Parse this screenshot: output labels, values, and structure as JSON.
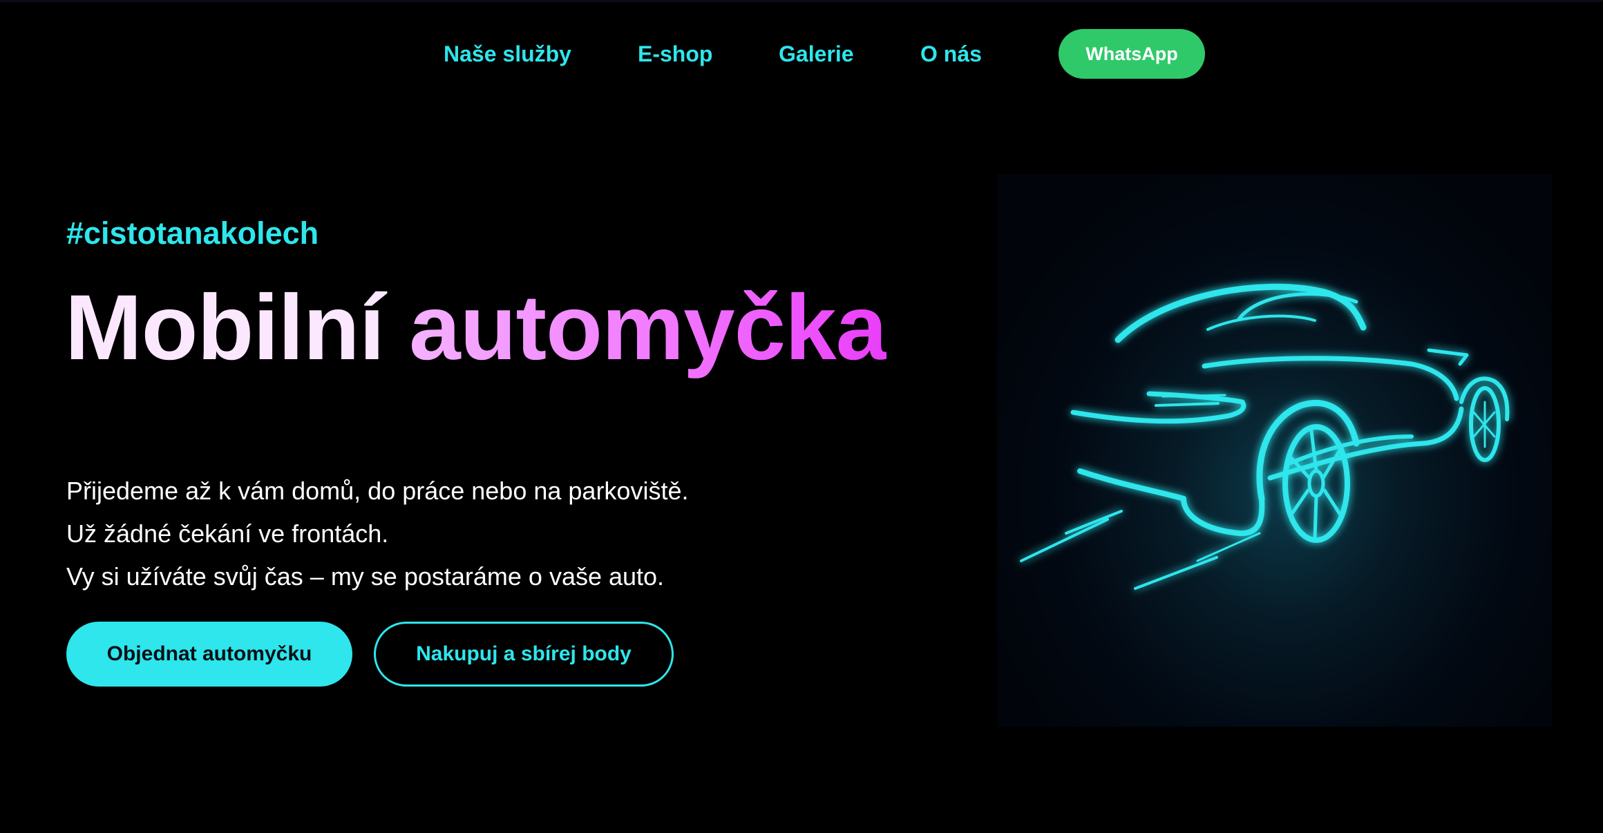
{
  "nav": {
    "links": [
      "Naše služby",
      "E-shop",
      "Galerie",
      "O nás"
    ],
    "whatsapp_label": "WhatsApp"
  },
  "hero": {
    "hashtag": "#cistotanakolech",
    "title_part1": "Mobilní",
    "title_part2": "automyčka",
    "lines": [
      "Přijedeme až k vám domů, do práce nebo na parkoviště.",
      "Už žádné čekání ve frontách.",
      "Vy si užíváte svůj čas – my se postaráme o vaše auto."
    ],
    "cta_primary": "Objednat automyčku",
    "cta_secondary": "Nakupuj a sbírej body"
  },
  "colors": {
    "accent_cyan": "#2ee6ec",
    "whatsapp_green": "#2fc96a",
    "title_gradient_start": "#f4b2ff",
    "title_gradient_end": "#ea3dfa",
    "background": "#000000"
  },
  "image": {
    "icon": "neon-car-icon"
  }
}
